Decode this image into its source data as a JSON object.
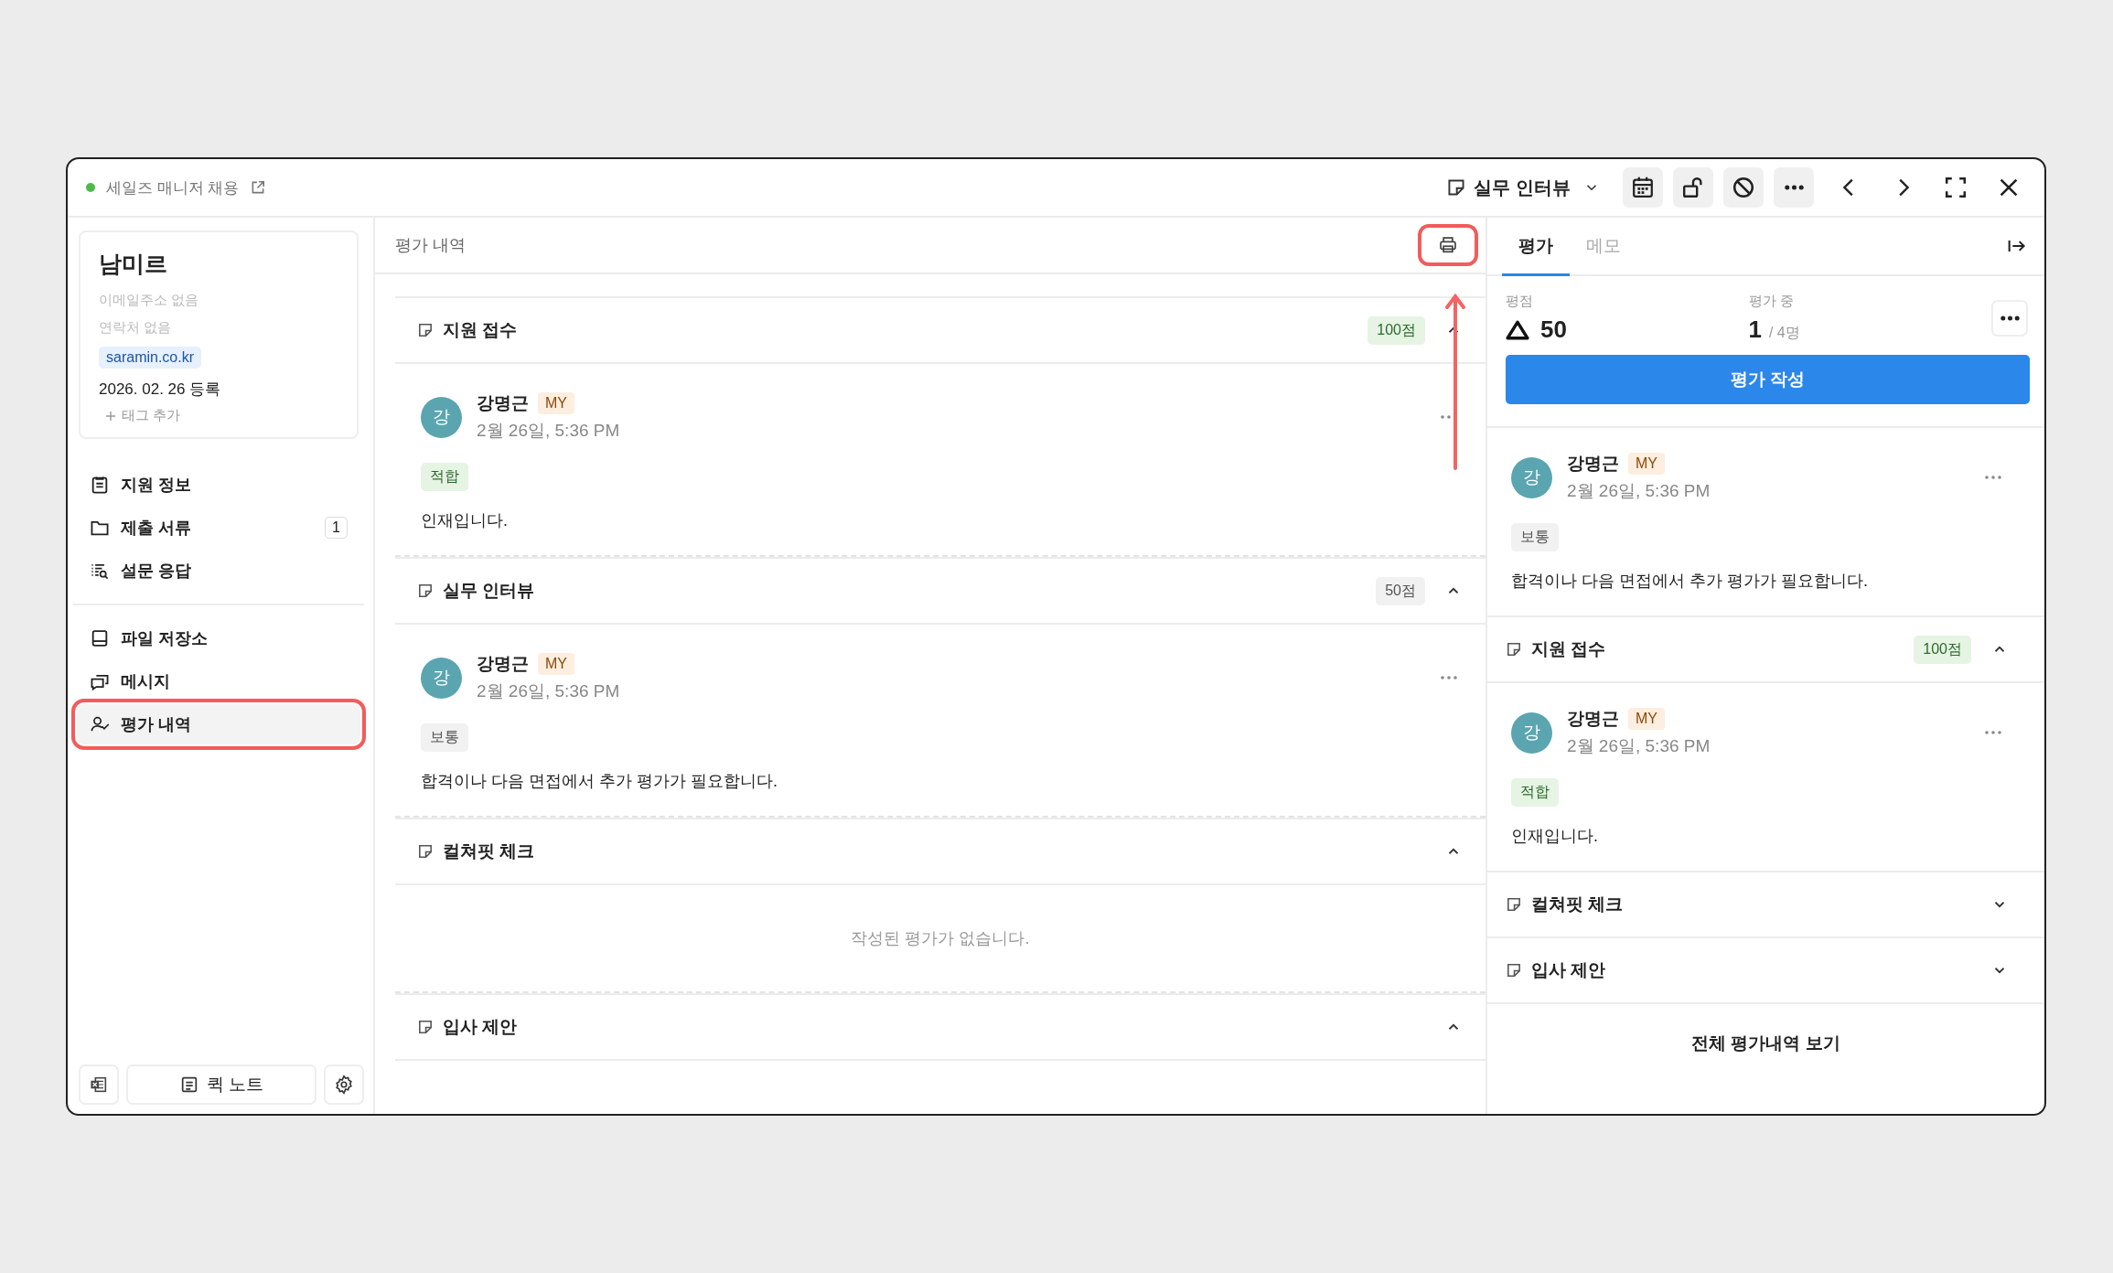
{
  "header": {
    "job_title": "세일즈 매니저 채용",
    "stage": "실무 인터뷰"
  },
  "candidate": {
    "name": "남미르",
    "email": "이메일주소 없음",
    "phone": "연락처 없음",
    "source": "saramin.co.kr",
    "registered": "2026. 02. 26  등록",
    "add_tag": "태그 추가"
  },
  "nav_groups": [
    [
      {
        "label": "지원 정보",
        "selected": false,
        "highlighted": false
      },
      {
        "label": "제출 서류",
        "badge": "1",
        "selected": false,
        "highlighted": false
      },
      {
        "label": "설문 응답",
        "selected": false,
        "highlighted": false
      }
    ],
    [
      {
        "label": "파일 저장소",
        "selected": false,
        "highlighted": false
      },
      {
        "label": "메시지",
        "selected": false,
        "highlighted": false
      },
      {
        "label": "평가 내역",
        "selected": true,
        "highlighted": true
      }
    ]
  ],
  "quick_note": "퀵 노트",
  "history": {
    "title": "평가 내역",
    "print_highlighted": true,
    "sections": [
      {
        "title": "지원 접수",
        "score": "100점",
        "kind": "positive",
        "expanded": true,
        "reviews": [
          {
            "avatar": "강",
            "name": "강명근",
            "badge": "MY",
            "time": "2월 26일, 5:36 PM",
            "verdict": "적합",
            "kind": "positive",
            "comment": "인재입니다."
          }
        ]
      },
      {
        "title": "실무 인터뷰",
        "score": "50점",
        "kind": "neutral",
        "expanded": true,
        "reviews": [
          {
            "avatar": "강",
            "name": "강명근",
            "badge": "MY",
            "time": "2월 26일, 5:36 PM",
            "verdict": "보통",
            "kind": "neutral",
            "comment": "합격이나 다음 면접에서 추가 평가가 필요합니다."
          }
        ]
      },
      {
        "title": "컬쳐핏 체크",
        "expanded": true,
        "empty": "작성된 평가가 없습니다."
      },
      {
        "title": "입사 제안",
        "expanded": true
      }
    ]
  },
  "panel": {
    "tabs": [
      {
        "label": "평가",
        "selected": true
      },
      {
        "label": "메모",
        "selected": false
      }
    ],
    "rating_label": "평점",
    "rating": "50",
    "progress_label": "평가 중",
    "progress_count": "1",
    "progress_total": "/ 4명",
    "write_button": "평가 작성",
    "latest": {
      "avatar": "강",
      "name": "강명근",
      "badge": "MY",
      "time": "2월 26일, 5:36 PM",
      "verdict": "보통",
      "kind": "neutral",
      "comment": "합격이나 다음 면접에서 추가 평가가 필요합니다."
    },
    "sections": [
      {
        "title": "지원 접수",
        "score": "100점",
        "kind": "positive",
        "expanded": true,
        "reviews": [
          {
            "avatar": "강",
            "name": "강명근",
            "badge": "MY",
            "time": "2월 26일, 5:36 PM",
            "verdict": "적합",
            "kind": "positive",
            "comment": "인재입니다."
          }
        ]
      },
      {
        "title": "컬쳐핏 체크",
        "expanded": false
      },
      {
        "title": "입사 제안",
        "expanded": false
      }
    ],
    "view_all": "전체 평가내역 보기"
  }
}
